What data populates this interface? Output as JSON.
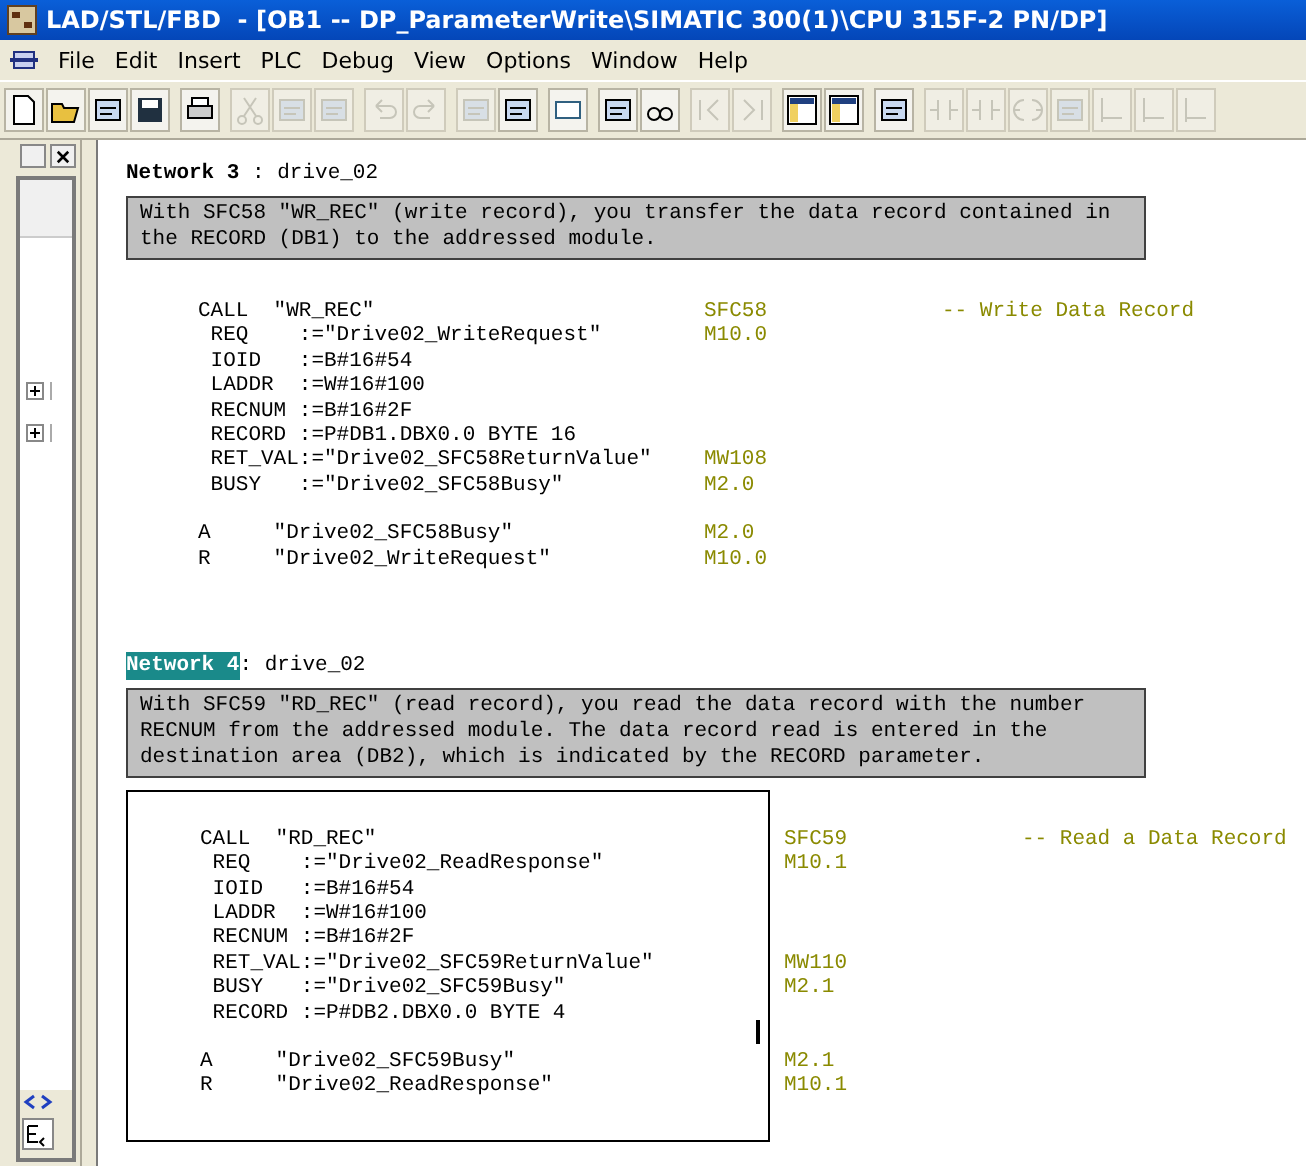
{
  "window": {
    "title": "LAD/STL/FBD  - [OB1 -- DP_ParameterWrite\\SIMATIC 300(1)\\CPU 315F-2 PN/DP]"
  },
  "menu": [
    "File",
    "Edit",
    "Insert",
    "PLC",
    "Debug",
    "View",
    "Options",
    "Window",
    "Help"
  ],
  "toolbar": [
    [
      {
        "disabled": false
      },
      {
        "disabled": false
      },
      {
        "disabled": false
      },
      {
        "disabled": false
      }
    ],
    [
      {
        "disabled": false
      }
    ],
    [
      {
        "disabled": true
      },
      {
        "disabled": true
      },
      {
        "disabled": true
      }
    ],
    [
      {
        "disabled": true
      },
      {
        "disabled": true
      }
    ],
    [
      {
        "disabled": true
      },
      {
        "disabled": false
      }
    ],
    [
      {
        "disabled": false
      }
    ],
    [
      {
        "disabled": false
      },
      {
        "disabled": false
      }
    ],
    [
      {
        "disabled": true
      },
      {
        "disabled": true
      }
    ],
    [
      {
        "disabled": false
      },
      {
        "disabled": false
      }
    ],
    [
      {
        "disabled": false
      }
    ],
    [
      {
        "disabled": true
      },
      {
        "disabled": true
      },
      {
        "disabled": true
      },
      {
        "disabled": true
      },
      {
        "disabled": true
      },
      {
        "disabled": true
      },
      {
        "disabled": true
      }
    ]
  ],
  "tree": [
    {
      "expanded": false
    },
    {
      "expanded": false
    }
  ],
  "networks": [
    {
      "label": "Network 3",
      "title": " : drive_02",
      "selected": false,
      "boxed": false,
      "comment": "With SFC58 \"WR_REC\" (write record), you transfer the data record contained in the RECORD (DB1) to the addressed module.",
      "blocks": [
        [
          {
            "code": "CALL  \"WR_REC\"",
            "address": "SFC58",
            "comment": "-- Write Data Record"
          },
          {
            "code": " REQ    :=\"Drive02_WriteRequest\"",
            "address": "M10.0"
          },
          {
            "code": " IOID   :=B#16#54"
          },
          {
            "code": " LADDR  :=W#16#100"
          },
          {
            "code": " RECNUM :=B#16#2F"
          },
          {
            "code": " RECORD :=P#DB1.DBX0.0 BYTE 16"
          },
          {
            "code": " RET_VAL:=\"Drive02_SFC58ReturnValue\"",
            "address": "MW108"
          },
          {
            "code": " BUSY   :=\"Drive02_SFC58Busy\"",
            "address": "M2.0"
          }
        ],
        [
          {
            "code": "A     \"Drive02_SFC58Busy\"",
            "address": "M2.0"
          },
          {
            "code": "R     \"Drive02_WriteRequest\"",
            "address": "M10.0"
          }
        ]
      ]
    },
    {
      "label": "Network 4",
      "title": ": drive_02",
      "selected": true,
      "boxed": true,
      "comment": "With SFC59 \"RD_REC\" (read record), you read the data record with the number RECNUM from the addressed module. The data record read is entered in the destination area (DB2), which is indicated by the RECORD parameter.",
      "blocks": [
        [
          {
            "code": "CALL  \"RD_REC\"",
            "address": "SFC59",
            "comment": "-- Read a Data Record"
          },
          {
            "code": " REQ    :=\"Drive02_ReadResponse\"",
            "address": "M10.1"
          },
          {
            "code": " IOID   :=B#16#54"
          },
          {
            "code": " LADDR  :=W#16#100"
          },
          {
            "code": " RECNUM :=B#16#2F"
          },
          {
            "code": " RET_VAL:=\"Drive02_SFC59ReturnValue\"",
            "address": "MW110"
          },
          {
            "code": " BUSY   :=\"Drive02_SFC59Busy\"",
            "address": "M2.1"
          },
          {
            "code": " RECORD :=P#DB2.DBX0.0 BYTE 4"
          }
        ],
        [
          {
            "code": "A     \"Drive02_SFC59Busy\"",
            "address": "M2.1"
          },
          {
            "code": "R     \"Drive02_ReadResponse\"",
            "address": "M10.1"
          }
        ]
      ]
    }
  ]
}
